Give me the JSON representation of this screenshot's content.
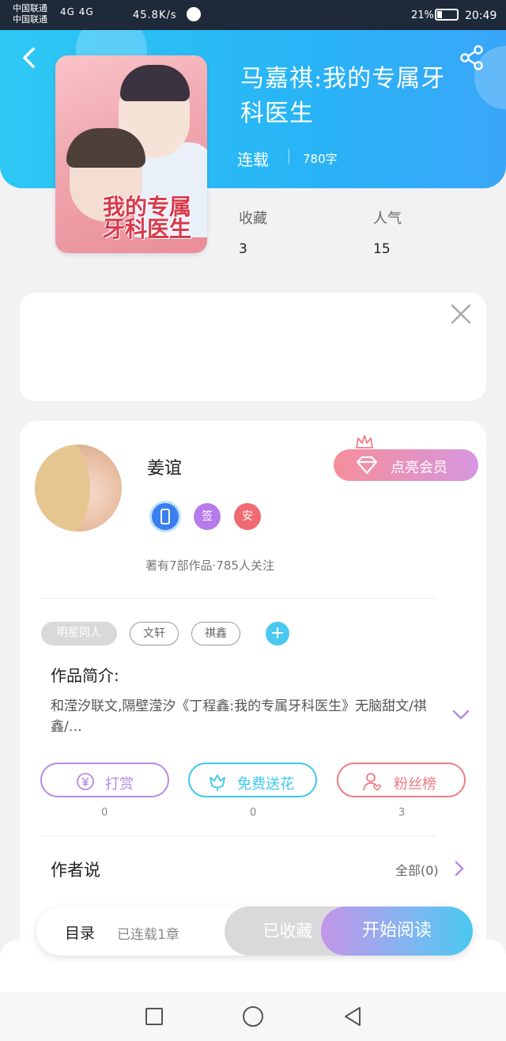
{
  "status_bar": {
    "carrier1": "中国联通",
    "carrier2": "中国联通",
    "signal": "4G 4G",
    "net_speed": "45.8K/s",
    "battery_pct": "21%",
    "time": "20:49"
  },
  "book": {
    "title": "马嘉祺:我的专属牙科医生",
    "cover_title": "我的专属牙科医生",
    "status": "连载",
    "word_count": "780字",
    "stats": [
      {
        "label": "收藏",
        "value": "3"
      },
      {
        "label": "人气",
        "value": "15"
      }
    ]
  },
  "author": {
    "name": "姜谊",
    "vip_label": "点亮会员",
    "badges": [
      {
        "text": "",
        "color": "#3a7ff0"
      },
      {
        "text": "签",
        "color": "#b67bea"
      },
      {
        "text": "安",
        "color": "#f06a72"
      }
    ],
    "meta": "著有7部作品·785人关注"
  },
  "tags": [
    "明星同人",
    "文轩",
    "祺鑫"
  ],
  "intro": {
    "title": "作品简介:",
    "text": "和滢汐联文,隔壁滢汐《丁程鑫:我的专属牙科医生》无脑甜文/祺鑫/…"
  },
  "actions": [
    {
      "label": "打赏",
      "count": "0",
      "color": "#b88ae6"
    },
    {
      "label": "免费送花",
      "count": "0",
      "color": "#3cc8ec"
    },
    {
      "label": "粉丝榜",
      "count": "3",
      "color": "#f07a82"
    }
  ],
  "author_says": {
    "title": "作者说",
    "all_label": "全部(0)"
  },
  "bottom_bar": {
    "toc": "目录",
    "chapters": "已连载1章",
    "collected": "已收藏",
    "read": "开始阅读"
  }
}
